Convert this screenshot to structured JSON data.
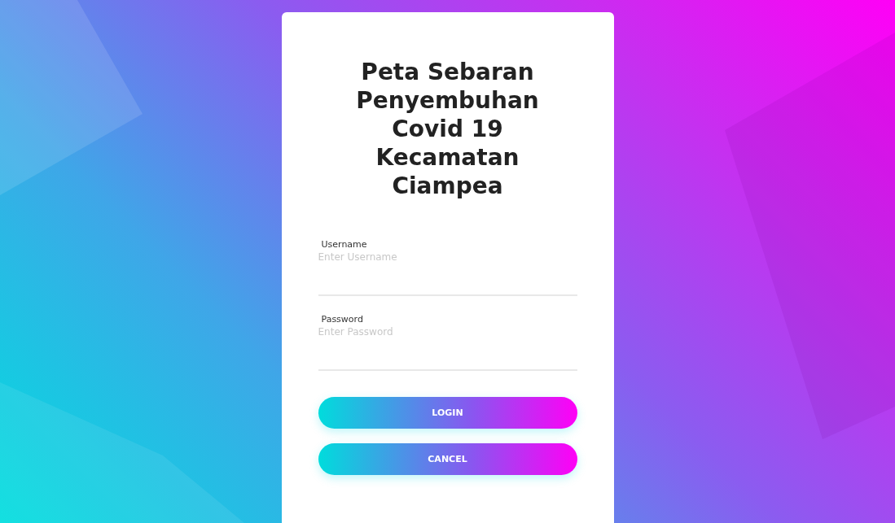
{
  "title": "Peta Sebaran Penyembuhan Covid 19 Kecamatan Ciampea",
  "fields": [
    {
      "label": "Username",
      "placeholder": "Enter Username"
    },
    {
      "label": "Password",
      "placeholder": "Enter Password"
    }
  ],
  "buttons": [
    "LOGIN",
    "CANCEL"
  ]
}
